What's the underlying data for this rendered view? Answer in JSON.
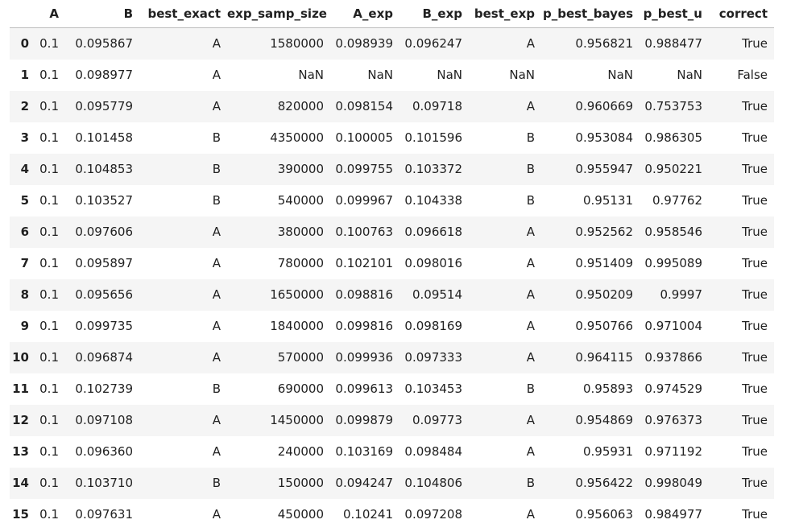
{
  "dataframe": {
    "columns": [
      "",
      "A",
      "B",
      "best_exact",
      "exp_samp_size",
      "A_exp",
      "B_exp",
      "best_exp",
      "p_best_bayes",
      "p_best_u",
      "correct"
    ],
    "rows": [
      [
        "0",
        "0.1",
        "0.095867",
        "A",
        "1580000",
        "0.098939",
        "0.096247",
        "A",
        "0.956821",
        "0.988477",
        "True"
      ],
      [
        "1",
        "0.1",
        "0.098977",
        "A",
        "NaN",
        "NaN",
        "NaN",
        "NaN",
        "NaN",
        "NaN",
        "False"
      ],
      [
        "2",
        "0.1",
        "0.095779",
        "A",
        "820000",
        "0.098154",
        "0.09718",
        "A",
        "0.960669",
        "0.753753",
        "True"
      ],
      [
        "3",
        "0.1",
        "0.101458",
        "B",
        "4350000",
        "0.100005",
        "0.101596",
        "B",
        "0.953084",
        "0.986305",
        "True"
      ],
      [
        "4",
        "0.1",
        "0.104853",
        "B",
        "390000",
        "0.099755",
        "0.103372",
        "B",
        "0.955947",
        "0.950221",
        "True"
      ],
      [
        "5",
        "0.1",
        "0.103527",
        "B",
        "540000",
        "0.099967",
        "0.104338",
        "B",
        "0.95131",
        "0.97762",
        "True"
      ],
      [
        "6",
        "0.1",
        "0.097606",
        "A",
        "380000",
        "0.100763",
        "0.096618",
        "A",
        "0.952562",
        "0.958546",
        "True"
      ],
      [
        "7",
        "0.1",
        "0.095897",
        "A",
        "780000",
        "0.102101",
        "0.098016",
        "A",
        "0.951409",
        "0.995089",
        "True"
      ],
      [
        "8",
        "0.1",
        "0.095656",
        "A",
        "1650000",
        "0.098816",
        "0.09514",
        "A",
        "0.950209",
        "0.9997",
        "True"
      ],
      [
        "9",
        "0.1",
        "0.099735",
        "A",
        "1840000",
        "0.099816",
        "0.098169",
        "A",
        "0.950766",
        "0.971004",
        "True"
      ],
      [
        "10",
        "0.1",
        "0.096874",
        "A",
        "570000",
        "0.099936",
        "0.097333",
        "A",
        "0.964115",
        "0.937866",
        "True"
      ],
      [
        "11",
        "0.1",
        "0.102739",
        "B",
        "690000",
        "0.099613",
        "0.103453",
        "B",
        "0.95893",
        "0.974529",
        "True"
      ],
      [
        "12",
        "0.1",
        "0.097108",
        "A",
        "1450000",
        "0.099879",
        "0.09773",
        "A",
        "0.954869",
        "0.976373",
        "True"
      ],
      [
        "13",
        "0.1",
        "0.096360",
        "A",
        "240000",
        "0.103169",
        "0.098484",
        "A",
        "0.95931",
        "0.971192",
        "True"
      ],
      [
        "14",
        "0.1",
        "0.103710",
        "B",
        "150000",
        "0.094247",
        "0.104806",
        "B",
        "0.956422",
        "0.998049",
        "True"
      ],
      [
        "15",
        "0.1",
        "0.097631",
        "A",
        "450000",
        "0.10241",
        "0.097208",
        "A",
        "0.956063",
        "0.984977",
        "True"
      ]
    ]
  }
}
